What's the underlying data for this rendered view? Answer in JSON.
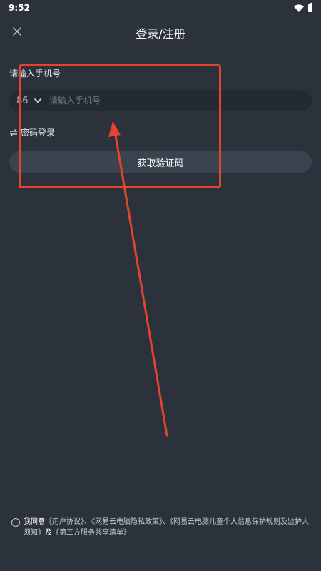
{
  "status_bar": {
    "time": "9:52"
  },
  "header": {
    "title": "登录/注册"
  },
  "phone": {
    "label": "请输入手机号",
    "country_code": "86",
    "placeholder": "请输入手机号"
  },
  "password_login": {
    "label": "密码登录"
  },
  "get_code_button": {
    "label": "获取验证码"
  },
  "agreement": {
    "prefix": "我同意",
    "user_agreement": "《用户协议》",
    "sep1": "、",
    "privacy_policy": "《网易云电脑隐私政策》",
    "sep2": "、",
    "child_privacy": "《网易云电脑儿童个人信息保护规则及监护人须知》",
    "and": "及",
    "third_party": "《第三方服务共享清单》"
  },
  "colors": {
    "background": "#2b323b",
    "input_bg": "#232a32",
    "button_bg": "#3a434e",
    "annotation": "#e2442f"
  }
}
